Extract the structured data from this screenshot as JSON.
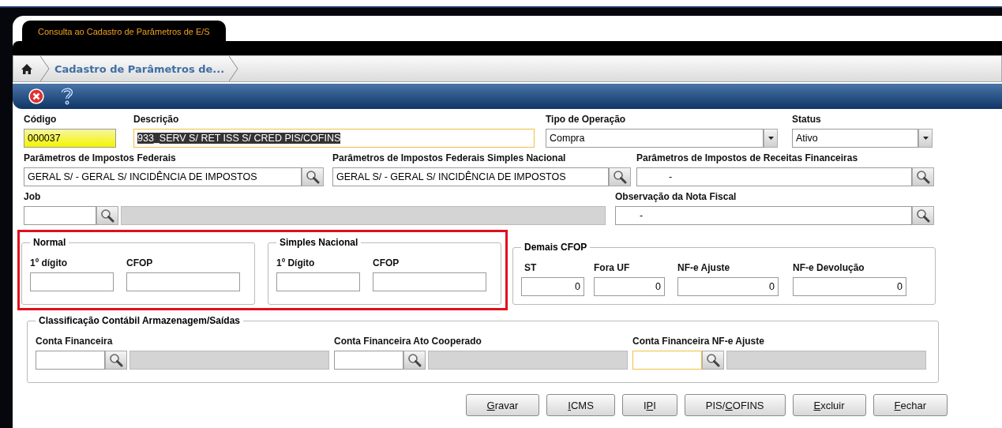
{
  "header": {
    "tab": "Consulta ao Cadastro de Parâmetros de E/S",
    "breadcrumb": "Cadastro de Parâmetros de..."
  },
  "form": {
    "codigo": {
      "label": "Código",
      "value": "000037",
      "highlighted": true
    },
    "descricao": {
      "label": "Descrição",
      "value": "933_SERV S/ RET ISS S/ CRED PIS/COFINS",
      "focused": true,
      "text_selected": true
    },
    "tipo_operacao": {
      "label": "Tipo de Operação",
      "value": "Compra"
    },
    "status": {
      "label": "Status",
      "value": "Ativo"
    },
    "impostos_federais": {
      "label": "Parâmetros de Impostos Federais",
      "value": "GERAL S/ - GERAL S/ INCIDÊNCIA DE IMPOSTOS"
    },
    "impostos_simples": {
      "label": "Parâmetros de Impostos Federais Simples Nacional",
      "value": "GERAL S/ - GERAL S/ INCIDÊNCIA DE IMPOSTOS"
    },
    "impostos_receitas": {
      "label": "Parâmetros de Impostos de Receitas Financeiras",
      "value": "-"
    },
    "job": {
      "label": "Job"
    },
    "observacao": {
      "label": "Observação da Nota Fiscal",
      "value": "-"
    }
  },
  "cfop": {
    "highlighted": true,
    "groups": [
      {
        "title": "Normal",
        "fields": [
          {
            "label": "1º dígito"
          },
          {
            "label": "CFOP"
          }
        ]
      },
      {
        "title": "Simples Nacional",
        "fields": [
          {
            "label": "1º Dígito"
          },
          {
            "label": "CFOP"
          }
        ]
      }
    ]
  },
  "demais_cfop": {
    "title": "Demais CFOP",
    "fields": [
      {
        "label": "ST",
        "value": "0"
      },
      {
        "label": "Fora UF",
        "value": "0"
      },
      {
        "label": "NF-e Ajuste",
        "value": "0"
      },
      {
        "label": "NF-e Devolução",
        "value": "0"
      }
    ]
  },
  "classificacao": {
    "title": "Classificação Contábil Armazenagem/Saídas",
    "fields": [
      {
        "label": "Conta Financeira",
        "focused": false
      },
      {
        "label": "Conta Financeira Ato Cooperado",
        "focused": false
      },
      {
        "label": "Conta Financeira NF-e Ajuste",
        "focused": true
      }
    ]
  },
  "buttons": [
    {
      "label_parts": [
        {
          "text": "G",
          "underlined": true
        },
        {
          "text": "ravar",
          "underlined": false
        }
      ]
    },
    {
      "label_parts": [
        {
          "text": "I",
          "underlined": true
        },
        {
          "text": "CMS",
          "underlined": false
        }
      ]
    },
    {
      "label_parts": [
        {
          "text": "I",
          "underlined": false
        },
        {
          "text": "P",
          "underlined": true
        },
        {
          "text": "I",
          "underlined": false
        }
      ]
    },
    {
      "label_parts": [
        {
          "text": "PIS/",
          "underlined": false
        },
        {
          "text": "C",
          "underlined": true
        },
        {
          "text": "OFINS",
          "underlined": false
        }
      ]
    },
    {
      "label_parts": [
        {
          "text": "E",
          "underlined": true
        },
        {
          "text": "xcluir",
          "underlined": false
        }
      ]
    },
    {
      "label_parts": [
        {
          "text": "F",
          "underlined": true
        },
        {
          "text": "echar",
          "underlined": false
        }
      ]
    }
  ]
}
